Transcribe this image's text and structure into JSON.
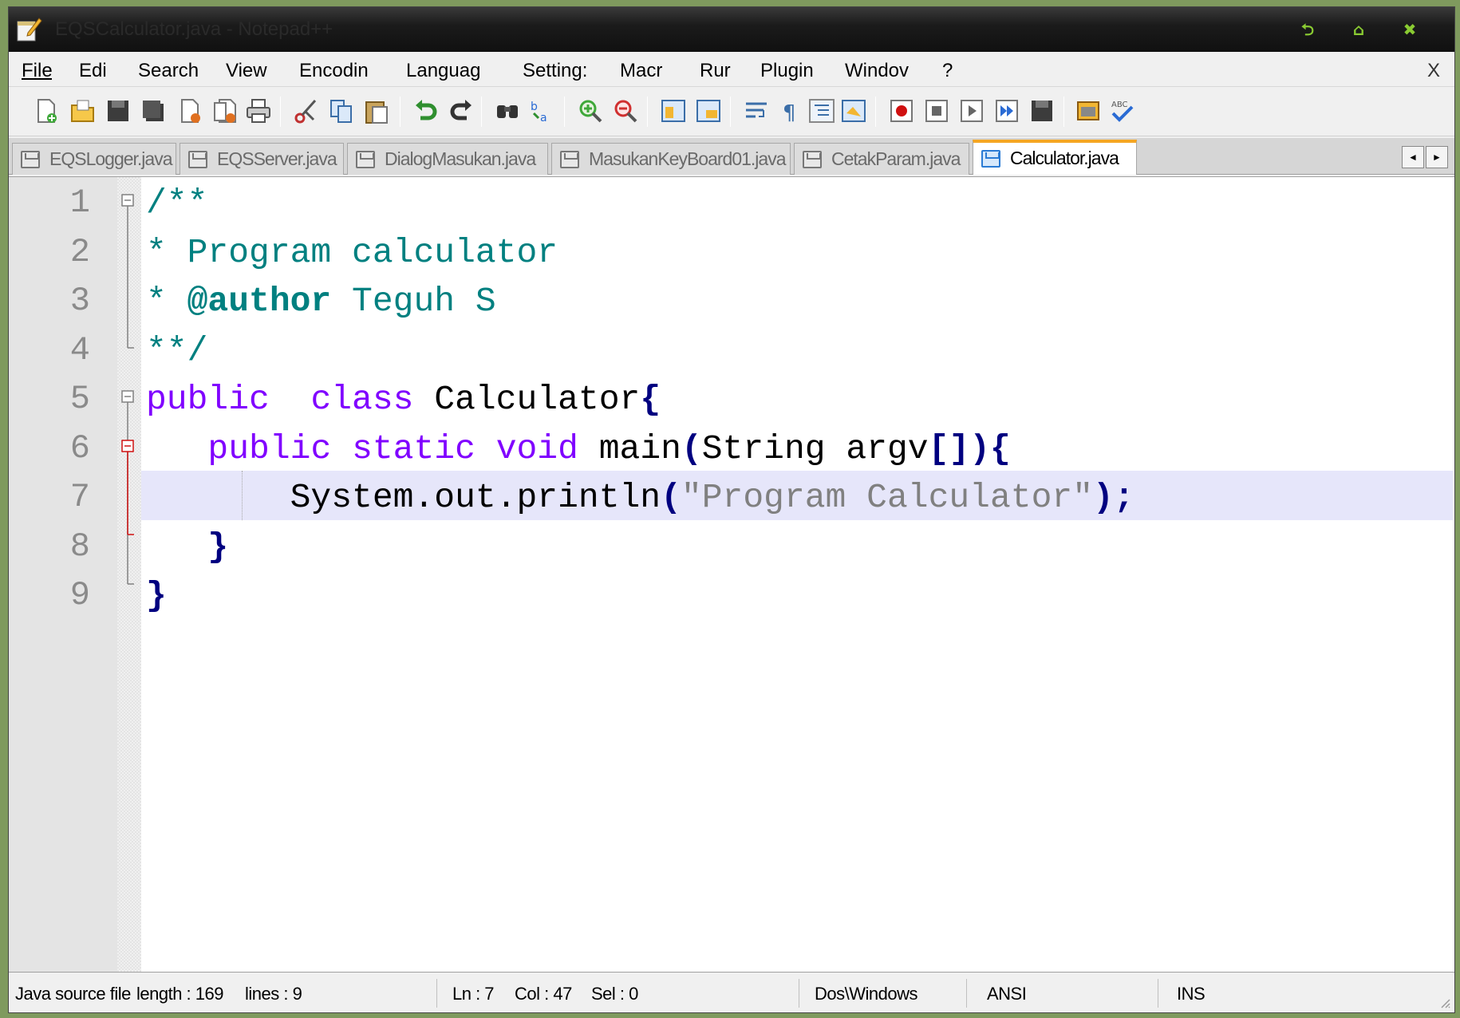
{
  "window": {
    "title": "EQSCalculator.java - Notepad++"
  },
  "title_buttons": [
    {
      "icon": "restore-icon",
      "glyph": "⮌"
    },
    {
      "icon": "home-icon",
      "glyph": "⌂"
    },
    {
      "icon": "close-icon",
      "glyph": "✖"
    }
  ],
  "menu": {
    "items": [
      "File",
      "Edit",
      "Search",
      "View",
      "Encoding",
      "Language",
      "Settings",
      "Macro",
      "Run",
      "Plugins",
      "Window",
      "?"
    ],
    "visible": [
      "File",
      "Edi",
      "Search",
      "View",
      "Encodin",
      "Languag",
      "Setting:",
      "Macr",
      "Rur",
      "Plugin",
      "Windov",
      "?"
    ],
    "close": "X"
  },
  "toolbar": {
    "icons": [
      "new-file-icon",
      "open-file-icon",
      "save-icon",
      "save-all-icon",
      "close-icon",
      "close-all-icon",
      "print-icon",
      "cut-icon",
      "copy-icon",
      "paste-icon",
      "undo-icon",
      "redo-icon",
      "find-icon",
      "replace-icon",
      "zoom-in-icon",
      "zoom-out-icon",
      "sync-vertical-icon",
      "sync-horizontal-icon",
      "word-wrap-icon",
      "show-all-chars-icon",
      "indent-guide-icon",
      "doc-map-icon",
      "record-macro-icon",
      "stop-record-icon",
      "play-macro-icon",
      "run-macro-multiple-icon",
      "save-macro-icon",
      "launch-browser-icon",
      "spell-check-icon"
    ]
  },
  "tabs": [
    {
      "label": "EQSLogger.java",
      "active": false
    },
    {
      "label": "EQSServer.java",
      "active": false
    },
    {
      "label": "DialogMasukan.java",
      "active": false
    },
    {
      "label": "MasukanKeyBoard01.java",
      "active": false
    },
    {
      "label": "CetakParam.java",
      "active": false
    },
    {
      "label": "Calculator.java",
      "active": true
    }
  ],
  "tab_scroll": {
    "left": "◄",
    "right": "►"
  },
  "editor": {
    "lines": [
      {
        "n": "1",
        "seg": [
          [
            "cm",
            "/**"
          ]
        ]
      },
      {
        "n": "2",
        "seg": [
          [
            "cm",
            "* Program calculator"
          ]
        ]
      },
      {
        "n": "3",
        "seg": [
          [
            "cm",
            "* "
          ],
          [
            "doc",
            "@author"
          ],
          [
            "cm",
            " Teguh S"
          ]
        ]
      },
      {
        "n": "4",
        "seg": [
          [
            "cm",
            "**/"
          ]
        ]
      },
      {
        "n": "5",
        "seg": [
          [
            "kw",
            "public"
          ],
          [
            "",
            "  "
          ],
          [
            "kw",
            "class"
          ],
          [
            "",
            " Calculator"
          ],
          [
            "op",
            "{"
          ]
        ]
      },
      {
        "n": "6",
        "seg": [
          [
            "",
            "   "
          ],
          [
            "kw",
            "public"
          ],
          [
            "",
            " "
          ],
          [
            "kw",
            "static"
          ],
          [
            "",
            " "
          ],
          [
            "kw",
            "void"
          ],
          [
            "",
            " main"
          ],
          [
            "op",
            "("
          ],
          [
            "",
            "String argv"
          ],
          [
            "op",
            "[])"
          ],
          [
            "op",
            "{"
          ]
        ]
      },
      {
        "n": "7",
        "seg": [
          [
            "",
            "       System.out.println"
          ],
          [
            "op",
            "("
          ],
          [
            "str",
            "\"Program Calculator\""
          ],
          [
            "op",
            ");"
          ]
        ]
      },
      {
        "n": "8",
        "seg": [
          [
            "",
            "   "
          ],
          [
            "op",
            "}"
          ]
        ]
      },
      {
        "n": "9",
        "seg": [
          [
            "op",
            "}"
          ]
        ]
      }
    ],
    "current_line": 7
  },
  "colors": {
    "comment": "#008080",
    "keyword": "#8000ff",
    "operator": "#000080",
    "string": "#808080",
    "current_line_bg": "#e6e6fa",
    "active_tab_accent": "#f5a623"
  },
  "status": {
    "file_type": "Java source file",
    "length": "length : 169",
    "lines": "lines : 9",
    "ln": "Ln : 7",
    "col": "Col : 47",
    "sel": "Sel : 0",
    "eol": "Dos\\Windows",
    "encoding": "ANSI",
    "mode": "INS"
  }
}
